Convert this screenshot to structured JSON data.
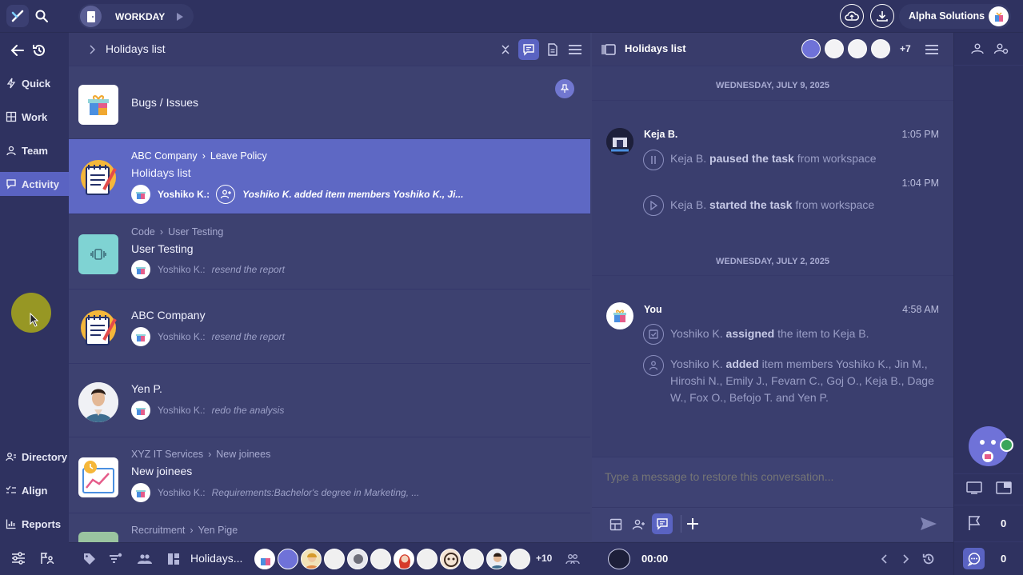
{
  "topbar": {
    "workspace_label": "WORKDAY",
    "org_name": "Alpha Solutions"
  },
  "nav": {
    "items": [
      {
        "label": "Quick",
        "icon": "bolt-icon"
      },
      {
        "label": "Work",
        "icon": "grid-icon"
      },
      {
        "label": "Team",
        "icon": "team-icon"
      },
      {
        "label": "Activity",
        "icon": "activity-icon"
      },
      {
        "label": "Directory",
        "icon": "directory-icon"
      },
      {
        "label": "Align",
        "icon": "align-icon"
      },
      {
        "label": "Reports",
        "icon": "reports-icon"
      }
    ],
    "active": "Activity"
  },
  "list": {
    "header_title": "Holidays list",
    "rows": [
      {
        "title": "Bugs / Issues"
      },
      {
        "crumb_a": "ABC Company",
        "crumb_b": "Leave Policy",
        "title": "Holidays list",
        "who": "Yoshiko K.:",
        "msg": "Yoshiko K. added item members Yoshiko K., Ji..."
      },
      {
        "crumb_a": "Code",
        "crumb_b": "User Testing",
        "title": "User Testing",
        "who": "Yoshiko K.:",
        "msg": "resend the report"
      },
      {
        "title": "ABC Company",
        "who": "Yoshiko K.:",
        "msg": "resend the report"
      },
      {
        "title": "Yen P.",
        "who": "Yoshiko K.:",
        "msg": "redo the analysis"
      },
      {
        "crumb_a": "XYZ IT Services",
        "crumb_b": "New joinees",
        "title": "New joinees",
        "who": "Yoshiko K.:",
        "msg": "Requirements:Bachelor's degree in Marketing, ..."
      },
      {
        "crumb_a": "Recruitment",
        "crumb_b": "Yen Pige"
      }
    ]
  },
  "chat": {
    "header_title": "Holidays list",
    "more_members": "+7",
    "day1": "WEDNESDAY, JULY 9, 2025",
    "day2": "WEDNESDAY, JULY 2, 2025",
    "msg1_name": "Keja B.",
    "msg1_time1": "1:05 PM",
    "msg1_line1_a": "Keja B.",
    "msg1_line1_b": "paused the task",
    "msg1_line1_c": "from workspace",
    "msg1_time2": "1:04 PM",
    "msg1_line2_a": "Keja B.",
    "msg1_line2_b": "started the task",
    "msg1_line2_c": "from workspace",
    "msg2_name": "You",
    "msg2_time": "4:58 AM",
    "msg2_line1_a": "Yoshiko K.",
    "msg2_line1_b": "assigned",
    "msg2_line1_c": "the item to Keja B.",
    "msg2_line2_a": "Yoshiko K.",
    "msg2_line2_b": "added",
    "msg2_line2_c": "item members Yoshiko K., Jin M., Hiroshi N., Emily J., Fevarn C., Goj O., Keja B., Dage W., Fox O., Befojo T. and Yen P.",
    "composer_placeholder": "Type a message to restore this conversation..."
  },
  "bottom": {
    "view_label": "Holidays...",
    "more_count": "+10",
    "timer": "00:00"
  },
  "rightrail": {
    "flag_count": "0",
    "chat_count": "0"
  },
  "colors": {
    "bg": "#3d4170",
    "bar": "#2f3260",
    "accent": "#5a63c2",
    "selected_row": "#5e68c4"
  }
}
